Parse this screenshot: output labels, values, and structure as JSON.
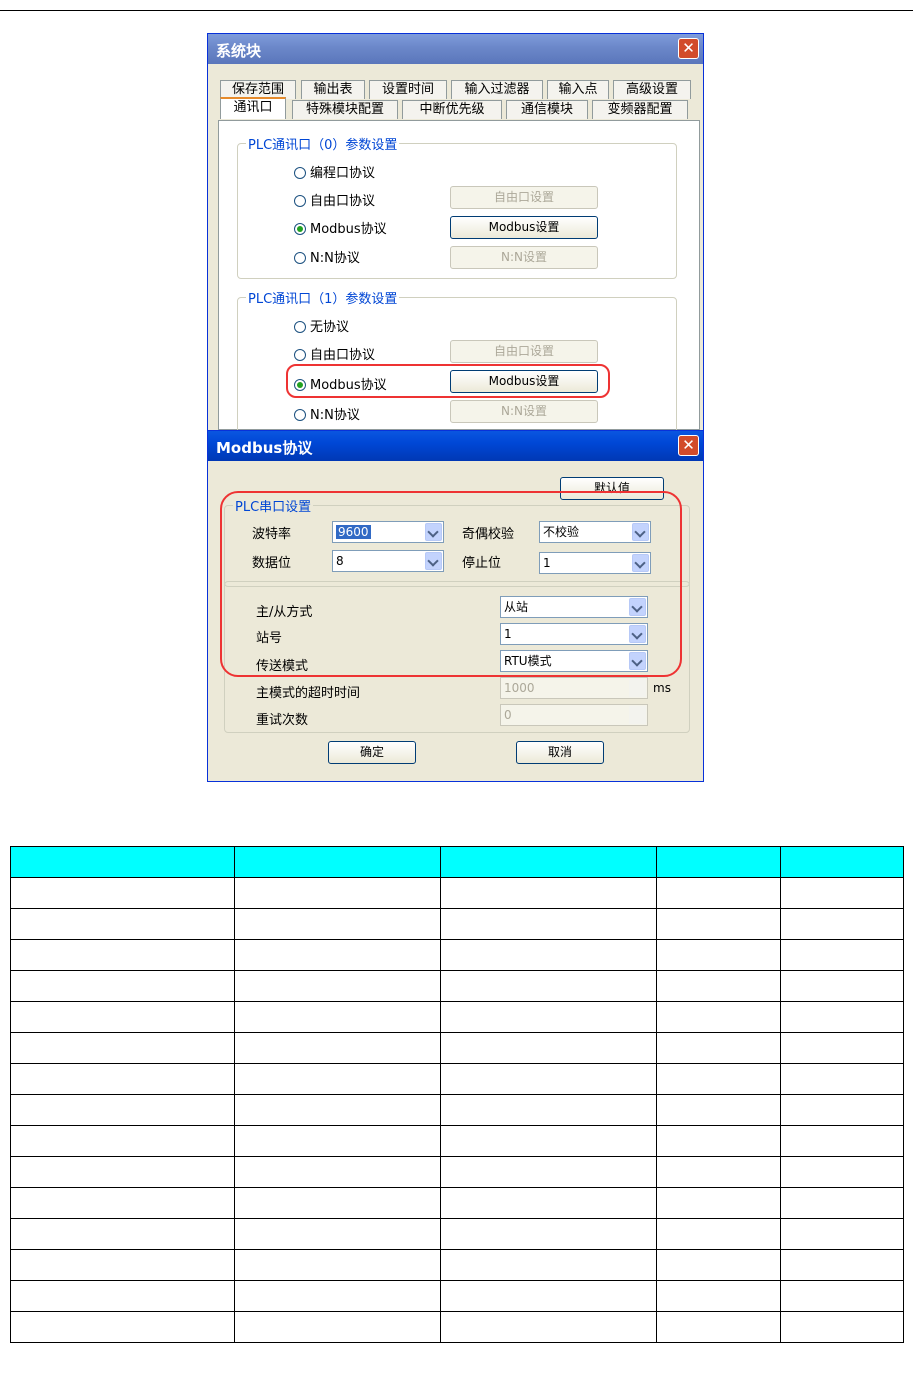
{
  "system_dialog": {
    "title": "系统块",
    "close_glyph": "✕",
    "tabs_row1": [
      "保存范围",
      "输出表",
      "设置时间",
      "输入过滤器",
      "输入点",
      "高级设置"
    ],
    "tabs_row2": [
      "通讯口",
      "特殊模块配置",
      "中断优先级",
      "通信模块",
      "变频器配置"
    ],
    "active_tab": "通讯口",
    "port0": {
      "title": "PLC通讯口（0）参数设置",
      "options": [
        "编程口协议",
        "自由口协议",
        "Modbus协议",
        "N:N协议"
      ],
      "selected": "Modbus协议",
      "buttons": [
        "自由口设置",
        "Modbus设置",
        "N:N设置"
      ]
    },
    "port1": {
      "title": "PLC通讯口（1）参数设置",
      "options": [
        "无协议",
        "自由口协议",
        "Modbus协议",
        "N:N协议"
      ],
      "selected": "Modbus协议",
      "buttons": [
        "自由口设置",
        "Modbus设置",
        "N:N设置"
      ]
    }
  },
  "modbus_dialog": {
    "title": "Modbus协议",
    "close_glyph": "✕",
    "default_button": "默认值",
    "serial_group_title": "PLC串口设置",
    "baud_label": "波特率",
    "baud_value": "9600",
    "parity_label": "奇偶校验",
    "parity_value": "不校验",
    "databits_label": "数据位",
    "databits_value": "8",
    "stopbits_label": "停止位",
    "stopbits_value": "1",
    "mode_label": "主/从方式",
    "mode_value": "从站",
    "station_label": "站号",
    "station_value": "1",
    "transfer_label": "传送模式",
    "transfer_value": "RTU模式",
    "timeout_label": "主模式的超时时间",
    "timeout_value": "1000",
    "timeout_unit": "ms",
    "retry_label": "重试次数",
    "retry_value": "0",
    "ok_button": "确定",
    "cancel_button": "取消"
  },
  "table": {
    "header_color": "#00ffff",
    "body_rows": 15,
    "columns": 5
  }
}
